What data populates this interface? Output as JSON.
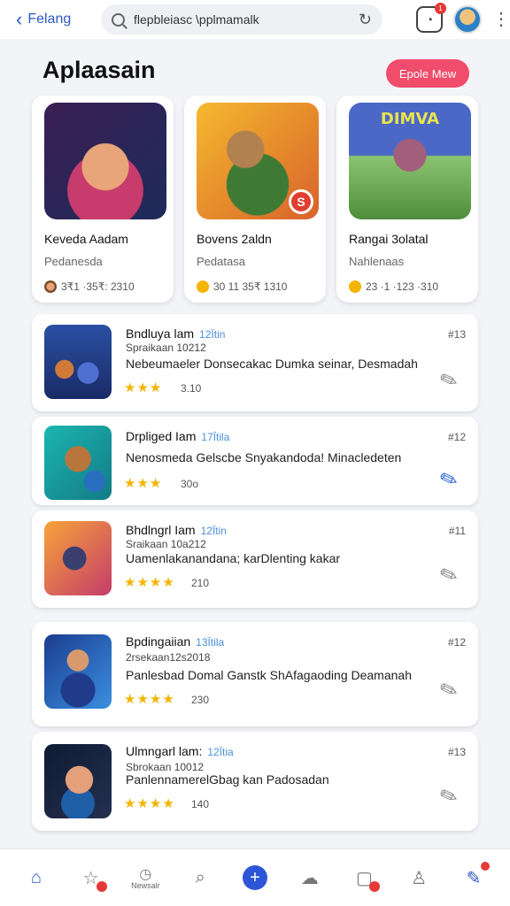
{
  "topbar": {
    "back_label": "Felang",
    "search_value": "flepbleiasc \\pplmamalk",
    "notif_badge": "1"
  },
  "header": {
    "title": "Aplaasain",
    "action_label": "Epole Mew"
  },
  "featured": [
    {
      "title": "Keveda Aadam",
      "subtitle": "Pedanesda",
      "meta": "3₹1 ·35₹: 2310"
    },
    {
      "title": "Bovens 2aldn",
      "subtitle": "Pedatasa",
      "meta": "30 11 35₹ 1310"
    },
    {
      "title": "Rangai 3olatal",
      "subtitle": "Nahlenaas",
      "meta": "23 ·1 ·123 ·310",
      "logo": "DIMVA"
    }
  ],
  "list": [
    {
      "name": "Bndluya lam",
      "tag": "12Ïtin",
      "small": "Spraikaan 10212",
      "desc": "Nebeumaeler Donsecakac Dumka seinar, Desmadah",
      "stars": "★★★",
      "rating": "3.10",
      "num": "#13"
    },
    {
      "name": "Drpliged Iam",
      "tag": "17Ïtila",
      "small": "",
      "desc": "Nenosmeda Gelscbe Snyakandoda! Minacledeten",
      "stars": "★★★",
      "rating": "30o",
      "num": "#12"
    },
    {
      "name": "Bhdlngrl Iam",
      "tag": "12Ïtin",
      "small": "Sraikaan 10a212",
      "desc": "Uamenlakanandana; karDlenting kakar",
      "stars": "★★★★",
      "rating": "210",
      "num": "#11"
    },
    {
      "name": "Bpdingaiian",
      "tag": "13Ïtila",
      "small": "2rsekaan12s2018",
      "desc": "Panlesbad Domal Ganstk ShAfagaoding Deamanah",
      "stars": "★★★★",
      "rating": "230",
      "num": "#12"
    },
    {
      "name": "Ulmngarl lam:",
      "tag": "12Ïtia",
      "small": "Sbrokaan 10012",
      "desc": "PanlennamerelGbag kan Padosadan",
      "stars": "★★★★",
      "rating": "140",
      "num": "#13"
    }
  ],
  "bottomnav": {
    "time_label": "Newsalr"
  },
  "colors": {
    "accent_blue": "#2b59c3",
    "pink_button": "#f04c6b",
    "star": "#f4b400",
    "badge_red": "#e53935"
  }
}
